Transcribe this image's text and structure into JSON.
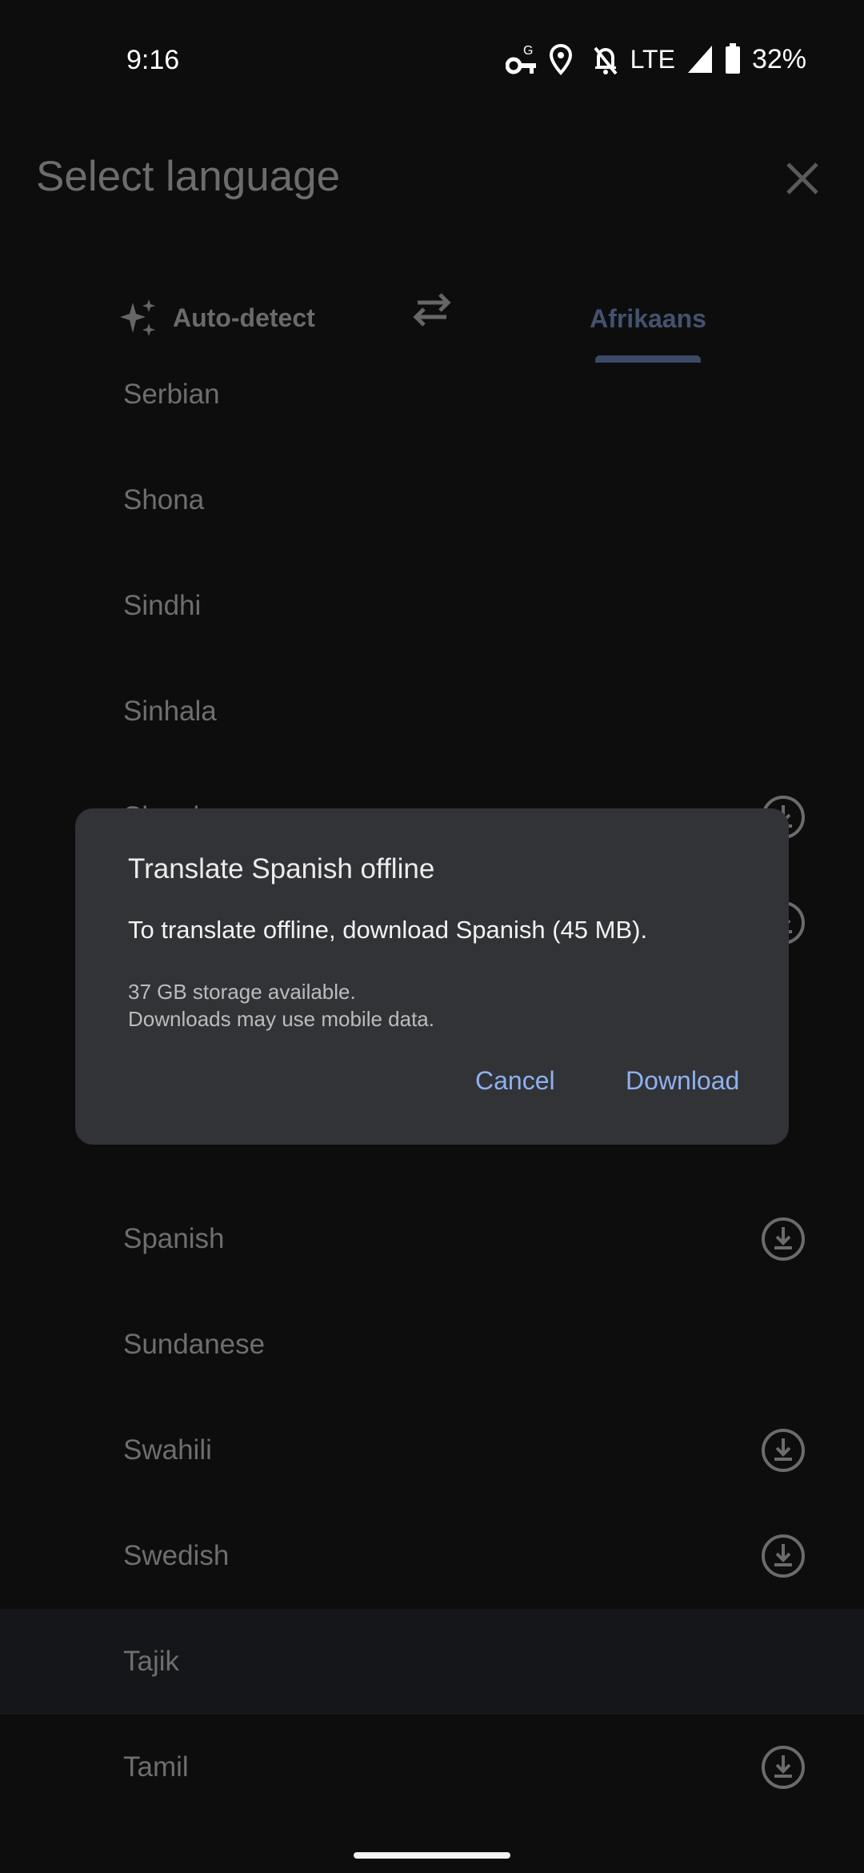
{
  "status_bar": {
    "time": "9:16",
    "network": "LTE",
    "battery": "32%",
    "icons": [
      "vpn-key-icon",
      "location-icon",
      "notifications-off-icon",
      "signal-icon",
      "battery-icon"
    ]
  },
  "header": {
    "title": "Select language",
    "close_icon": "close-icon"
  },
  "tabs": {
    "source": {
      "label": "Auto-detect",
      "icon": "sparkle-icon"
    },
    "swap_icon": "swap-icon",
    "target": {
      "label": "Afrikaans",
      "selected": true
    }
  },
  "languages": {
    "serbian": {
      "label": "Serbian"
    },
    "shona": {
      "label": "Shona"
    },
    "sindhi": {
      "label": "Sindhi"
    },
    "sinhala": {
      "label": "Sinhala"
    },
    "slovak": {
      "label": "Slovak",
      "downloadable": true
    },
    "spanish": {
      "label": "Spanish",
      "downloadable": true
    },
    "sundanese": {
      "label": "Sundanese"
    },
    "swahili": {
      "label": "Swahili",
      "downloadable": true
    },
    "swedish": {
      "label": "Swedish",
      "downloadable": true
    },
    "tajik": {
      "label": "Tajik",
      "highlighted": true
    },
    "tamil": {
      "label": "Tamil",
      "downloadable": true
    }
  },
  "dialog": {
    "title": "Translate Spanish offline",
    "body": "To translate offline, download Spanish (45 MB).",
    "storage": "37 GB storage available.",
    "data_note": "Downloads may use mobile data.",
    "cancel_label": "Cancel",
    "download_label": "Download"
  },
  "colors": {
    "background": "#0d0d0d",
    "dialog": "#323337",
    "accent": "#8fb1ee",
    "tab_selected": "#44526e"
  }
}
